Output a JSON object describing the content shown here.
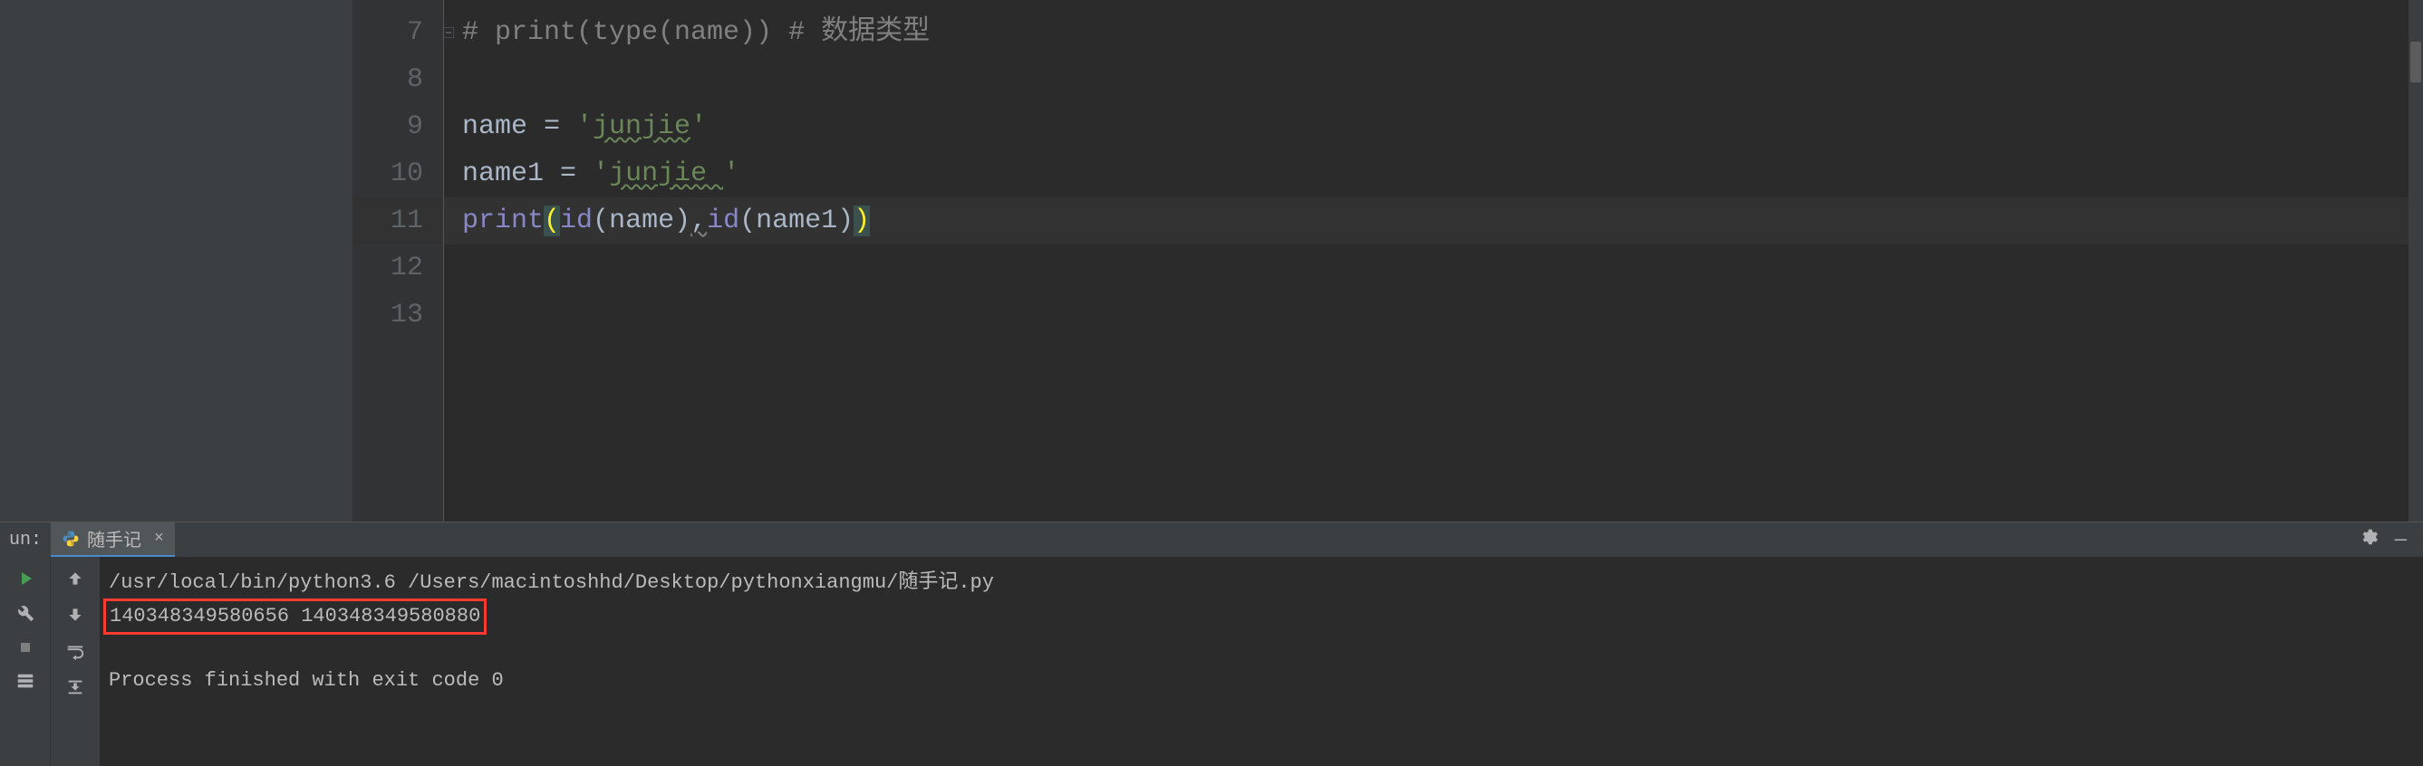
{
  "editor": {
    "lines": [
      {
        "num": "7",
        "tokens": [
          {
            "cls": "comment",
            "text": "# "
          },
          {
            "cls": "comment",
            "text": "print(type(name)) # 数据类型"
          }
        ],
        "fold": true
      },
      {
        "num": "8",
        "tokens": []
      },
      {
        "num": "9",
        "tokens": [
          {
            "cls": "identifier",
            "text": "name "
          },
          {
            "cls": "operator",
            "text": "= "
          },
          {
            "cls": "string",
            "text": "'"
          },
          {
            "cls": "string typo-underline",
            "text": "junjie"
          },
          {
            "cls": "string",
            "text": "'"
          }
        ]
      },
      {
        "num": "10",
        "tokens": [
          {
            "cls": "identifier",
            "text": "name1 "
          },
          {
            "cls": "operator",
            "text": "= "
          },
          {
            "cls": "string",
            "text": "'"
          },
          {
            "cls": "string typo-underline",
            "text": "junjie "
          },
          {
            "cls": "string",
            "text": "'"
          }
        ]
      },
      {
        "num": "11",
        "active": true,
        "tokens": [
          {
            "cls": "keyword-builtin",
            "text": "print"
          },
          {
            "cls": "paren highlight-paren",
            "text": "("
          },
          {
            "cls": "keyword-builtin",
            "text": "id"
          },
          {
            "cls": "paren",
            "text": "("
          },
          {
            "cls": "identifier",
            "text": "name"
          },
          {
            "cls": "paren",
            "text": ")"
          },
          {
            "cls": "operator weak-warn",
            "text": ","
          },
          {
            "cls": "keyword-builtin",
            "text": "id"
          },
          {
            "cls": "paren",
            "text": "("
          },
          {
            "cls": "identifier",
            "text": "name1"
          },
          {
            "cls": "paren",
            "text": ")"
          },
          {
            "cls": "paren highlight-paren",
            "text": ")"
          }
        ]
      },
      {
        "num": "12",
        "tokens": []
      },
      {
        "num": "13",
        "tokens": []
      }
    ]
  },
  "run": {
    "label": "un:",
    "tab_name": "随手记",
    "console": {
      "cmd": "/usr/local/bin/python3.6 /Users/macintoshhd/Desktop/pythonxiangmu/随手记.py",
      "output": "140348349580656 140348349580880",
      "finished": "Process finished with exit code 0"
    }
  }
}
